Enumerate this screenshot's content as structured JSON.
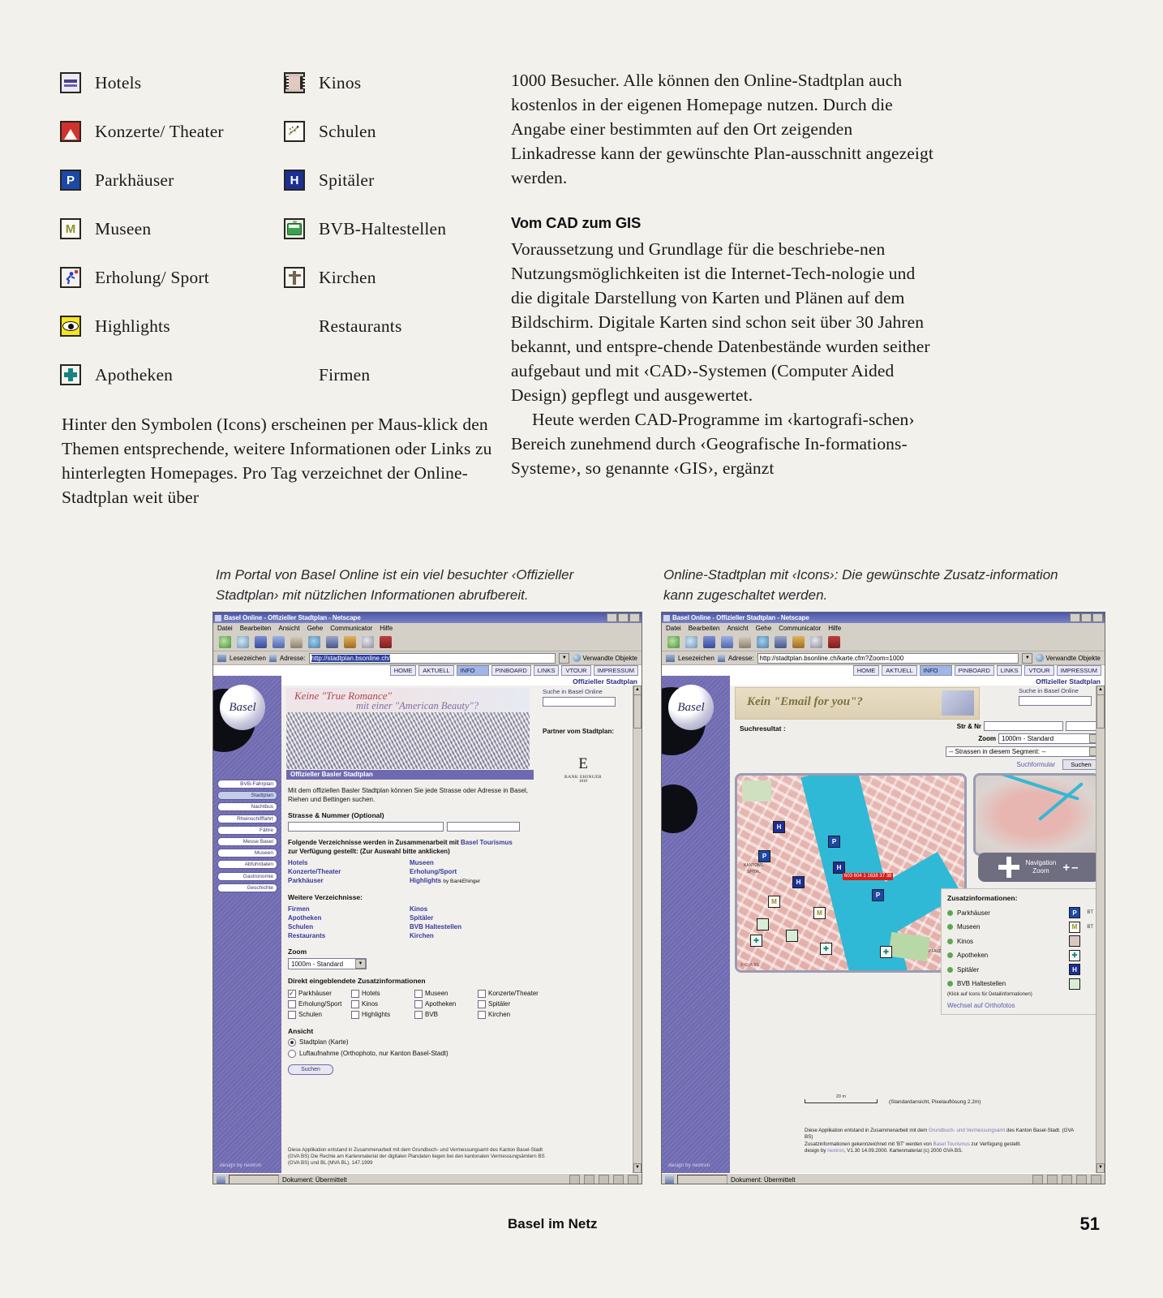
{
  "legend": {
    "left": [
      {
        "label": "Hotels",
        "icon": "hotel-bed-icon"
      },
      {
        "label": "Konzerte/ Theater",
        "icon": "theater-icon"
      },
      {
        "label": "Parkhäuser",
        "icon": "parking-p-icon"
      },
      {
        "label": "Museen",
        "icon": "museum-m-icon"
      },
      {
        "label": "Erholung/ Sport",
        "icon": "sport-icon"
      },
      {
        "label": "Highlights",
        "icon": "eye-highlight-icon"
      },
      {
        "label": "Apotheken",
        "icon": "pharmacy-cross-icon"
      }
    ],
    "right": [
      {
        "label": "Kinos",
        "icon": "film-strip-icon"
      },
      {
        "label": "Schulen",
        "icon": "school-icon"
      },
      {
        "label": "Spitäler",
        "icon": "hospital-h-icon"
      },
      {
        "label": "BVB-Haltestellen",
        "icon": "tram-icon"
      },
      {
        "label": "Kirchen",
        "icon": "church-cross-icon"
      },
      {
        "label": "Restaurants",
        "icon": "restaurant-blob-icon"
      },
      {
        "label": "Firmen",
        "icon": "company-blob-icon"
      }
    ]
  },
  "article": {
    "left_paragraph": "Hinter den Symbolen (Icons) erscheinen per Maus-klick den Themen entsprechende, weitere Informationen oder Links zu hinterlegten Homepages. Pro Tag verzeichnet der Online-Stadtplan weit über",
    "right_paragraph_1": "1000 Besucher. Alle können den Online-Stadtplan auch kostenlos in der eigenen Homepage nutzen. Durch die Angabe einer bestimmten auf den Ort zeigenden Linkadresse kann der gewünschte Plan-ausschnitt angezeigt werden.",
    "subhead": "Vom CAD zum GIS",
    "right_paragraph_2": "Voraussetzung und Grundlage für die beschriebe-nen Nutzungsmöglichkeiten ist die Internet-Tech-nologie und die digitale Darstellung von Karten und Plänen auf dem Bildschirm. Digitale Karten sind schon seit über 30 Jahren bekannt, und entspre-chende Datenbestände wurden seither aufgebaut und mit ‹CAD›-Systemen (Computer Aided Design) gepflegt und ausgewertet.",
    "right_paragraph_3": "Heute werden CAD-Programme im ‹kartografi-schen› Bereich zunehmend durch ‹Geografische In-formations-Systeme›, so genannte ‹GIS›, ergänzt"
  },
  "captions": {
    "left": "Im Portal von Basel Online ist ein viel besuchter ‹Offizieller Stadtplan› mit nützlichen Informationen abrufbereit.",
    "right": "Online-Stadtplan mit ‹Icons›: Die gewünschte Zusatz-information kann zugeschaltet werden."
  },
  "browser_common": {
    "title": "Basel Online - Offizieller Stadtplan - Netscape",
    "menu": [
      "Datei",
      "Bearbeiten",
      "Ansicht",
      "Gehe",
      "Communicator",
      "Hilfe"
    ],
    "bookmarks_label": "Lesezeichen",
    "address_label": "Adresse:",
    "related_label": "Verwandte Objekte",
    "status_text": "Dokument: Übermittelt",
    "site_nav": [
      "HOME",
      "AKTUELL",
      "INFO",
      "PINBOARD",
      "LINKS",
      "VTOUR",
      "IMPRESSUM"
    ],
    "site_nav_active": "INFO",
    "site_title": "Offizieller Stadtplan",
    "logo_text": "Basel",
    "design_by": "design by nextron"
  },
  "left_window": {
    "url": "http://stadtplan.bsonline.ch/",
    "sidebar": [
      "BVB-Fahrplan",
      "Stadtplan",
      "Nachtbus",
      "Rheinschifffahrt",
      "Fähre",
      "Messe Basel",
      "Museen",
      "Abfuhrdaten",
      "Gastronomie",
      "Geschichte"
    ],
    "sidebar_active": "Stadtplan",
    "banner_line1": "Keine \"True Romance\"",
    "banner_line2": "mit einer \"American Beauty\"?",
    "section_header": "Offizieller Basler Stadtplan",
    "intro": "Mit dem offiziellen Basler Stadtplan können Sie jede Strasse oder Adresse in Basel, Riehen und Bettingen suchen.",
    "street_label": "Strasse & Nummer (Optional)",
    "dir_intro_1": "Folgende Verzeichnisse werden in Zusammenarbeit mit ",
    "dir_intro_link": "Basel Tourismus",
    "dir_intro_2": "zur Verfügung gestellt: (Zur Auswahl bitte anklicken)",
    "dir_col1": [
      "Hotels",
      "Konzerte/Theater",
      "Parkhäuser"
    ],
    "dir_col2": [
      "Museen",
      "Erholung/Sport",
      "Highlights"
    ],
    "highlights_suffix": "by BankEhinger",
    "more_label": "Weitere Verzeichnisse:",
    "more_col1": [
      "Firmen",
      "Apotheken",
      "Schulen",
      "Restaurants"
    ],
    "more_col2": [
      "Kinos",
      "Spitäler",
      "BVB Haltestellen",
      "Kirchen"
    ],
    "zoom_label": "Zoom",
    "zoom_value": "1000m - Standard",
    "extra_label": "Direkt eingeblendete Zusatzinformationen",
    "checkboxes": [
      {
        "label": "Parkhäuser",
        "checked": true
      },
      {
        "label": "Hotels",
        "checked": false
      },
      {
        "label": "Museen",
        "checked": false
      },
      {
        "label": "Konzerte/Theater",
        "checked": false
      },
      {
        "label": "Erholung/Sport",
        "checked": false
      },
      {
        "label": "Kinos",
        "checked": false
      },
      {
        "label": "Apotheken",
        "checked": false
      },
      {
        "label": "Spitäler",
        "checked": false
      },
      {
        "label": "Schulen",
        "checked": false
      },
      {
        "label": "Highlights",
        "checked": false
      },
      {
        "label": "BVB",
        "checked": false
      },
      {
        "label": "Kirchen",
        "checked": false
      }
    ],
    "view_label": "Ansicht",
    "radios": [
      {
        "label": "Stadtplan (Karte)",
        "selected": true
      },
      {
        "label": "Luftaufnahme (Orthophoto, nur Kanton Basel-Stadt)",
        "selected": false
      }
    ],
    "submit_label": "Suchen",
    "search_site_label": "Suche in Basel Online",
    "partner_label": "Partner vom Stadtplan:",
    "bank_mark": "E",
    "bank_name": "BANK EHINGER",
    "bank_year": "1810",
    "footnote": "Diese Applikation entstand in Zusammenarbeit mit dem Grundbuch- und Vermessungsamt des Kanton Basel-Stadt (GVA BS) Die Rechte am Kartenmaterial der digitalen Plandaten liegen bei den kantonalen Vermessungsämtern BS (GVA BS) und BL (MVA BL). 147.1999"
  },
  "right_window": {
    "url": "http://stadtplan.bsonline.ch/karte.cfm?Zoom=1000",
    "banner_text": "Kein \"Email for you\"?",
    "result_label": "Suchresultat :",
    "str_label": "Str & Nr",
    "zoom_label": "Zoom",
    "zoom_value": "1000m - Standard",
    "segment_select": "-- Strassen in diesem Segment: --",
    "form_link": "Suchformular",
    "search_button": "Suchen",
    "search_site_label": "Suche in Basel Online",
    "nav_label": "Navigation",
    "nav_zoom_label": "Zoom",
    "zoom_plus": "+",
    "zoom_minus": "–",
    "extra_title": "Zusatzinformationen:",
    "extra_items": [
      {
        "label": "Parkhäuser",
        "icon": "parking-p-icon",
        "glyph": "P",
        "tag": "BT"
      },
      {
        "label": "Museen",
        "icon": "museum-m-icon",
        "glyph": "M",
        "tag": "BT"
      },
      {
        "label": "Kinos",
        "icon": "film-strip-icon",
        "glyph": "",
        "tag": ""
      },
      {
        "label": "Apotheken",
        "icon": "pharmacy-cross-icon",
        "glyph": "",
        "tag": ""
      },
      {
        "label": "Spitäler",
        "icon": "hospital-h-icon",
        "glyph": "H",
        "tag": ""
      },
      {
        "label": "BVB Haltestellen",
        "icon": "tram-icon",
        "glyph": "",
        "tag": ""
      }
    ],
    "extra_note": "(Klick auf Icons für Detailinformationen)",
    "ortho_link": "Wechsel auf Orthofotos",
    "map_labels": [
      "KANTONS",
      "SPITAL",
      "PFALZ"
    ],
    "map_callout": "603 604 1 1638 37 38",
    "map_copyright": "© GVA BS",
    "scale_value": "20 m",
    "standard_note": "(Standardansicht, Pixelauflösung 2.2m)",
    "footer_line1a": "Diese Applikation entstand in Zusammenarbeit mit dem ",
    "footer_line1b": "Grundbuch- und Vermessungsamt",
    "footer_line1c": " des Kanton Basel-Stadt. (GVA BS)",
    "footer_line2a": "Zusatzinformationen gekennzeichnet mit 'BT' werden von ",
    "footer_line2b": "Basel Tourismus",
    "footer_line2c": " zur Verfügung gestellt.",
    "footer_line3a": "design by ",
    "footer_line3b": "nextron",
    "footer_line3c": ", V1.30 14.09.2000. Kartenmaterial (c) 2000 GVA BS."
  },
  "footer": {
    "title": "Basel im Netz",
    "page_number": "51"
  }
}
